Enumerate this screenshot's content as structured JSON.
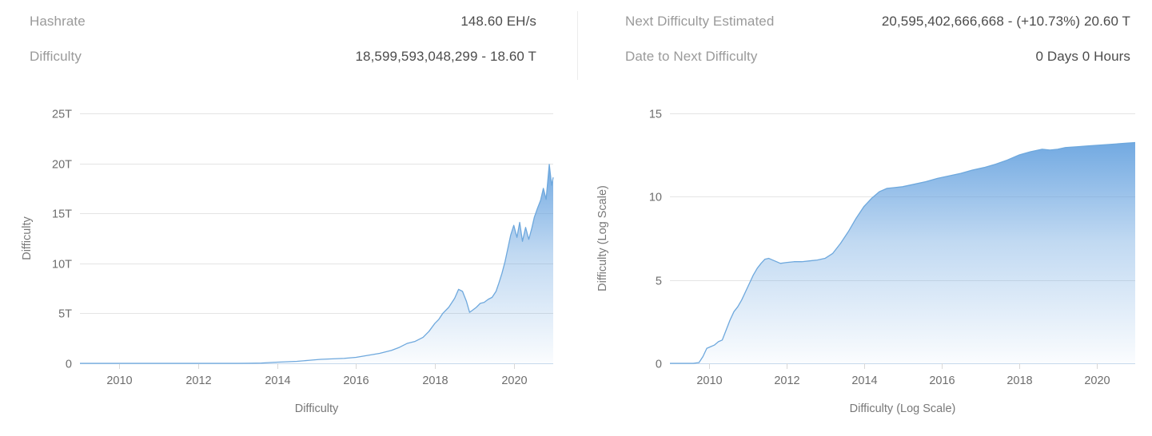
{
  "panels": [
    {
      "stats": [
        {
          "label": "Hashrate",
          "value": "148.60 EH/s"
        },
        {
          "label": "Difficulty",
          "value": "18,599,593,048,299 - 18.60 T"
        }
      ]
    },
    {
      "stats": [
        {
          "label": "Next Difficulty Estimated",
          "value": "20,595,402,666,668 - (+10.73%) 20.60 T"
        },
        {
          "label": "Date to Next Difficulty",
          "value": "0 Days 0 Hours"
        }
      ]
    }
  ],
  "colors": {
    "line": "#6ea8dd",
    "fill_top": "#6ba5e0",
    "fill_bottom": "#ffffff",
    "grid": "#e4e4e4",
    "label_text": "#9a9a9a",
    "value_text": "#4c4c4c",
    "tick_text": "#6d6d6d",
    "divider": "#ececec"
  },
  "chart_data": [
    {
      "type": "area",
      "title": "",
      "xlabel": "Difficulty",
      "ylabel": "Difficulty",
      "xticks": [
        "2010",
        "2012",
        "2014",
        "2016",
        "2018",
        "2020"
      ],
      "xtick_values": [
        2010,
        2012,
        2014,
        2016,
        2018,
        2020
      ],
      "yticks": [
        "0",
        "5T",
        "10T",
        "15T",
        "20T",
        "25T"
      ],
      "ytick_values": [
        0,
        5,
        10,
        15,
        20,
        25
      ],
      "ylim": [
        0,
        25
      ],
      "xlim": [
        2009,
        2021
      ],
      "grid": true,
      "legend": "none",
      "units": "T (trillions)",
      "x": [
        2009.0,
        2009.5,
        2010.0,
        2010.5,
        2011.0,
        2011.5,
        2012.0,
        2012.5,
        2013.0,
        2013.3,
        2013.6,
        2013.9,
        2014.2,
        2014.5,
        2014.8,
        2015.1,
        2015.4,
        2015.7,
        2016.0,
        2016.3,
        2016.6,
        2016.9,
        2017.1,
        2017.3,
        2017.5,
        2017.7,
        2017.85,
        2018.0,
        2018.1,
        2018.2,
        2018.35,
        2018.5,
        2018.6,
        2018.7,
        2018.8,
        2018.88,
        2018.95,
        2019.05,
        2019.15,
        2019.25,
        2019.35,
        2019.45,
        2019.55,
        2019.62,
        2019.7,
        2019.78,
        2019.85,
        2019.92,
        2020.0,
        2020.08,
        2020.15,
        2020.22,
        2020.3,
        2020.38,
        2020.45,
        2020.52,
        2020.6,
        2020.68,
        2020.75,
        2020.82,
        2020.9,
        2020.96,
        2021.0
      ],
      "y": [
        0.0,
        0.0,
        0.0,
        0.0,
        0.0,
        0.0,
        0.0,
        0.0,
        0.0,
        0.01,
        0.03,
        0.1,
        0.15,
        0.2,
        0.3,
        0.4,
        0.45,
        0.5,
        0.6,
        0.8,
        1.0,
        1.3,
        1.6,
        2.0,
        2.2,
        2.6,
        3.2,
        4.0,
        4.4,
        5.0,
        5.6,
        6.5,
        7.4,
        7.2,
        6.2,
        5.1,
        5.3,
        5.6,
        6.0,
        6.1,
        6.4,
        6.6,
        7.2,
        8.0,
        9.0,
        10.2,
        11.5,
        12.8,
        13.8,
        12.6,
        14.1,
        12.2,
        13.6,
        12.4,
        13.4,
        14.6,
        15.5,
        16.3,
        17.5,
        16.4,
        19.9,
        17.8,
        18.6
      ]
    },
    {
      "type": "area",
      "title": "",
      "xlabel": "Difficulty (Log Scale)",
      "ylabel": "Difficulty (Log Scale)",
      "xticks": [
        "2010",
        "2012",
        "2014",
        "2016",
        "2018",
        "2020"
      ],
      "xtick_values": [
        2010,
        2012,
        2014,
        2016,
        2018,
        2020
      ],
      "yticks": [
        "0",
        "5",
        "10",
        "15"
      ],
      "ytick_values": [
        0,
        5,
        10,
        15
      ],
      "ylim": [
        0,
        15
      ],
      "xlim": [
        2009,
        2021
      ],
      "grid": true,
      "legend": "none",
      "units": "log of difficulty",
      "x": [
        2009.0,
        2009.6,
        2009.75,
        2009.85,
        2009.95,
        2010.05,
        2010.15,
        2010.25,
        2010.35,
        2010.45,
        2010.55,
        2010.65,
        2010.75,
        2010.85,
        2010.95,
        2011.05,
        2011.15,
        2011.25,
        2011.35,
        2011.45,
        2011.55,
        2011.7,
        2011.85,
        2012.0,
        2012.2,
        2012.4,
        2012.6,
        2012.8,
        2013.0,
        2013.2,
        2013.4,
        2013.6,
        2013.8,
        2014.0,
        2014.2,
        2014.4,
        2014.6,
        2014.8,
        2015.0,
        2015.3,
        2015.6,
        2015.9,
        2016.2,
        2016.5,
        2016.8,
        2017.1,
        2017.4,
        2017.7,
        2018.0,
        2018.3,
        2018.6,
        2018.8,
        2019.0,
        2019.2,
        2019.5,
        2019.8,
        2020.1,
        2020.4,
        2020.7,
        2021.0
      ],
      "y": [
        0.0,
        0.0,
        0.05,
        0.4,
        0.9,
        1.0,
        1.1,
        1.3,
        1.4,
        2.0,
        2.6,
        3.1,
        3.4,
        3.8,
        4.3,
        4.8,
        5.3,
        5.7,
        6.0,
        6.25,
        6.3,
        6.15,
        6.0,
        6.05,
        6.1,
        6.1,
        6.15,
        6.2,
        6.3,
        6.6,
        7.2,
        7.9,
        8.7,
        9.4,
        9.9,
        10.3,
        10.5,
        10.55,
        10.6,
        10.75,
        10.9,
        11.1,
        11.25,
        11.4,
        11.6,
        11.75,
        11.95,
        12.2,
        12.5,
        12.7,
        12.85,
        12.8,
        12.85,
        12.95,
        13.0,
        13.05,
        13.1,
        13.15,
        13.2,
        13.25
      ]
    }
  ]
}
